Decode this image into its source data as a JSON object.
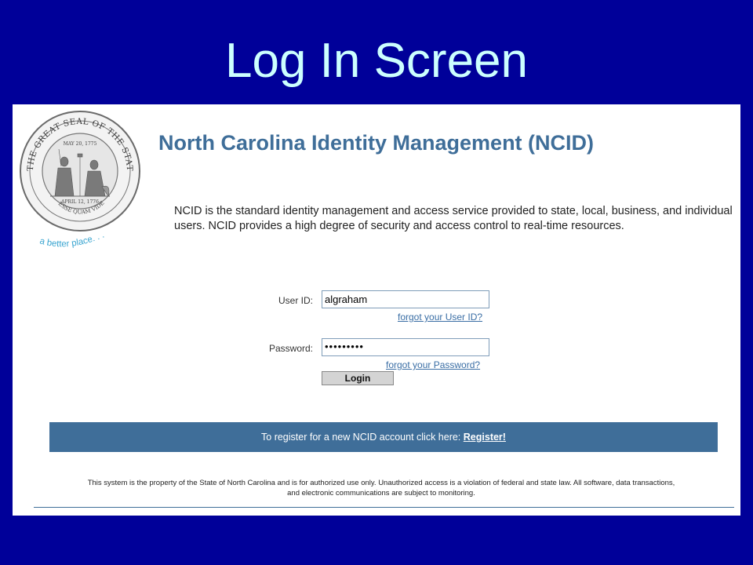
{
  "slide": {
    "title": "Log In Screen"
  },
  "logo": {
    "name": "great-seal-of-north-carolina",
    "seal_text": "THE GREAT SEAL OF THE STATE OF NORTH CAROLINA",
    "date_top": "MAY 20, 1775",
    "date_bottom": "APRIL 12, 1776",
    "motto": "ESSE QUAM VIDERI",
    "tagline": "a better place. . ."
  },
  "header": {
    "title": "North Carolina Identity Management (NCID)"
  },
  "intro": {
    "text": "NCID is the standard identity management and access service provided to state, local, business, and individual users. NCID provides a high degree of security and access control to real-time resources."
  },
  "login_form": {
    "user_id_label": "User ID:",
    "user_id_value": "algraham",
    "forgot_user_id": "forgot your User ID?",
    "password_label": "Password:",
    "password_value": "•••••••••",
    "forgot_password": "forgot your Password?",
    "login_button": "Login"
  },
  "register_bar": {
    "text": "To register for a new NCID account click here:",
    "link": "Register!"
  },
  "footer": {
    "disclaimer_line1": "This system is the property of the State of North Carolina and is for authorized use only. Unauthorized access is a violation of federal and state law. All software, data transactions,",
    "disclaimer_line2": "and electronic communications are subject to monitoring."
  },
  "colors": {
    "slide_background": "#000099",
    "slide_title": "#ccffff",
    "accent_blue": "#3f6e99",
    "link": "#3a6ea5",
    "tagline": "#3aa5d0"
  }
}
